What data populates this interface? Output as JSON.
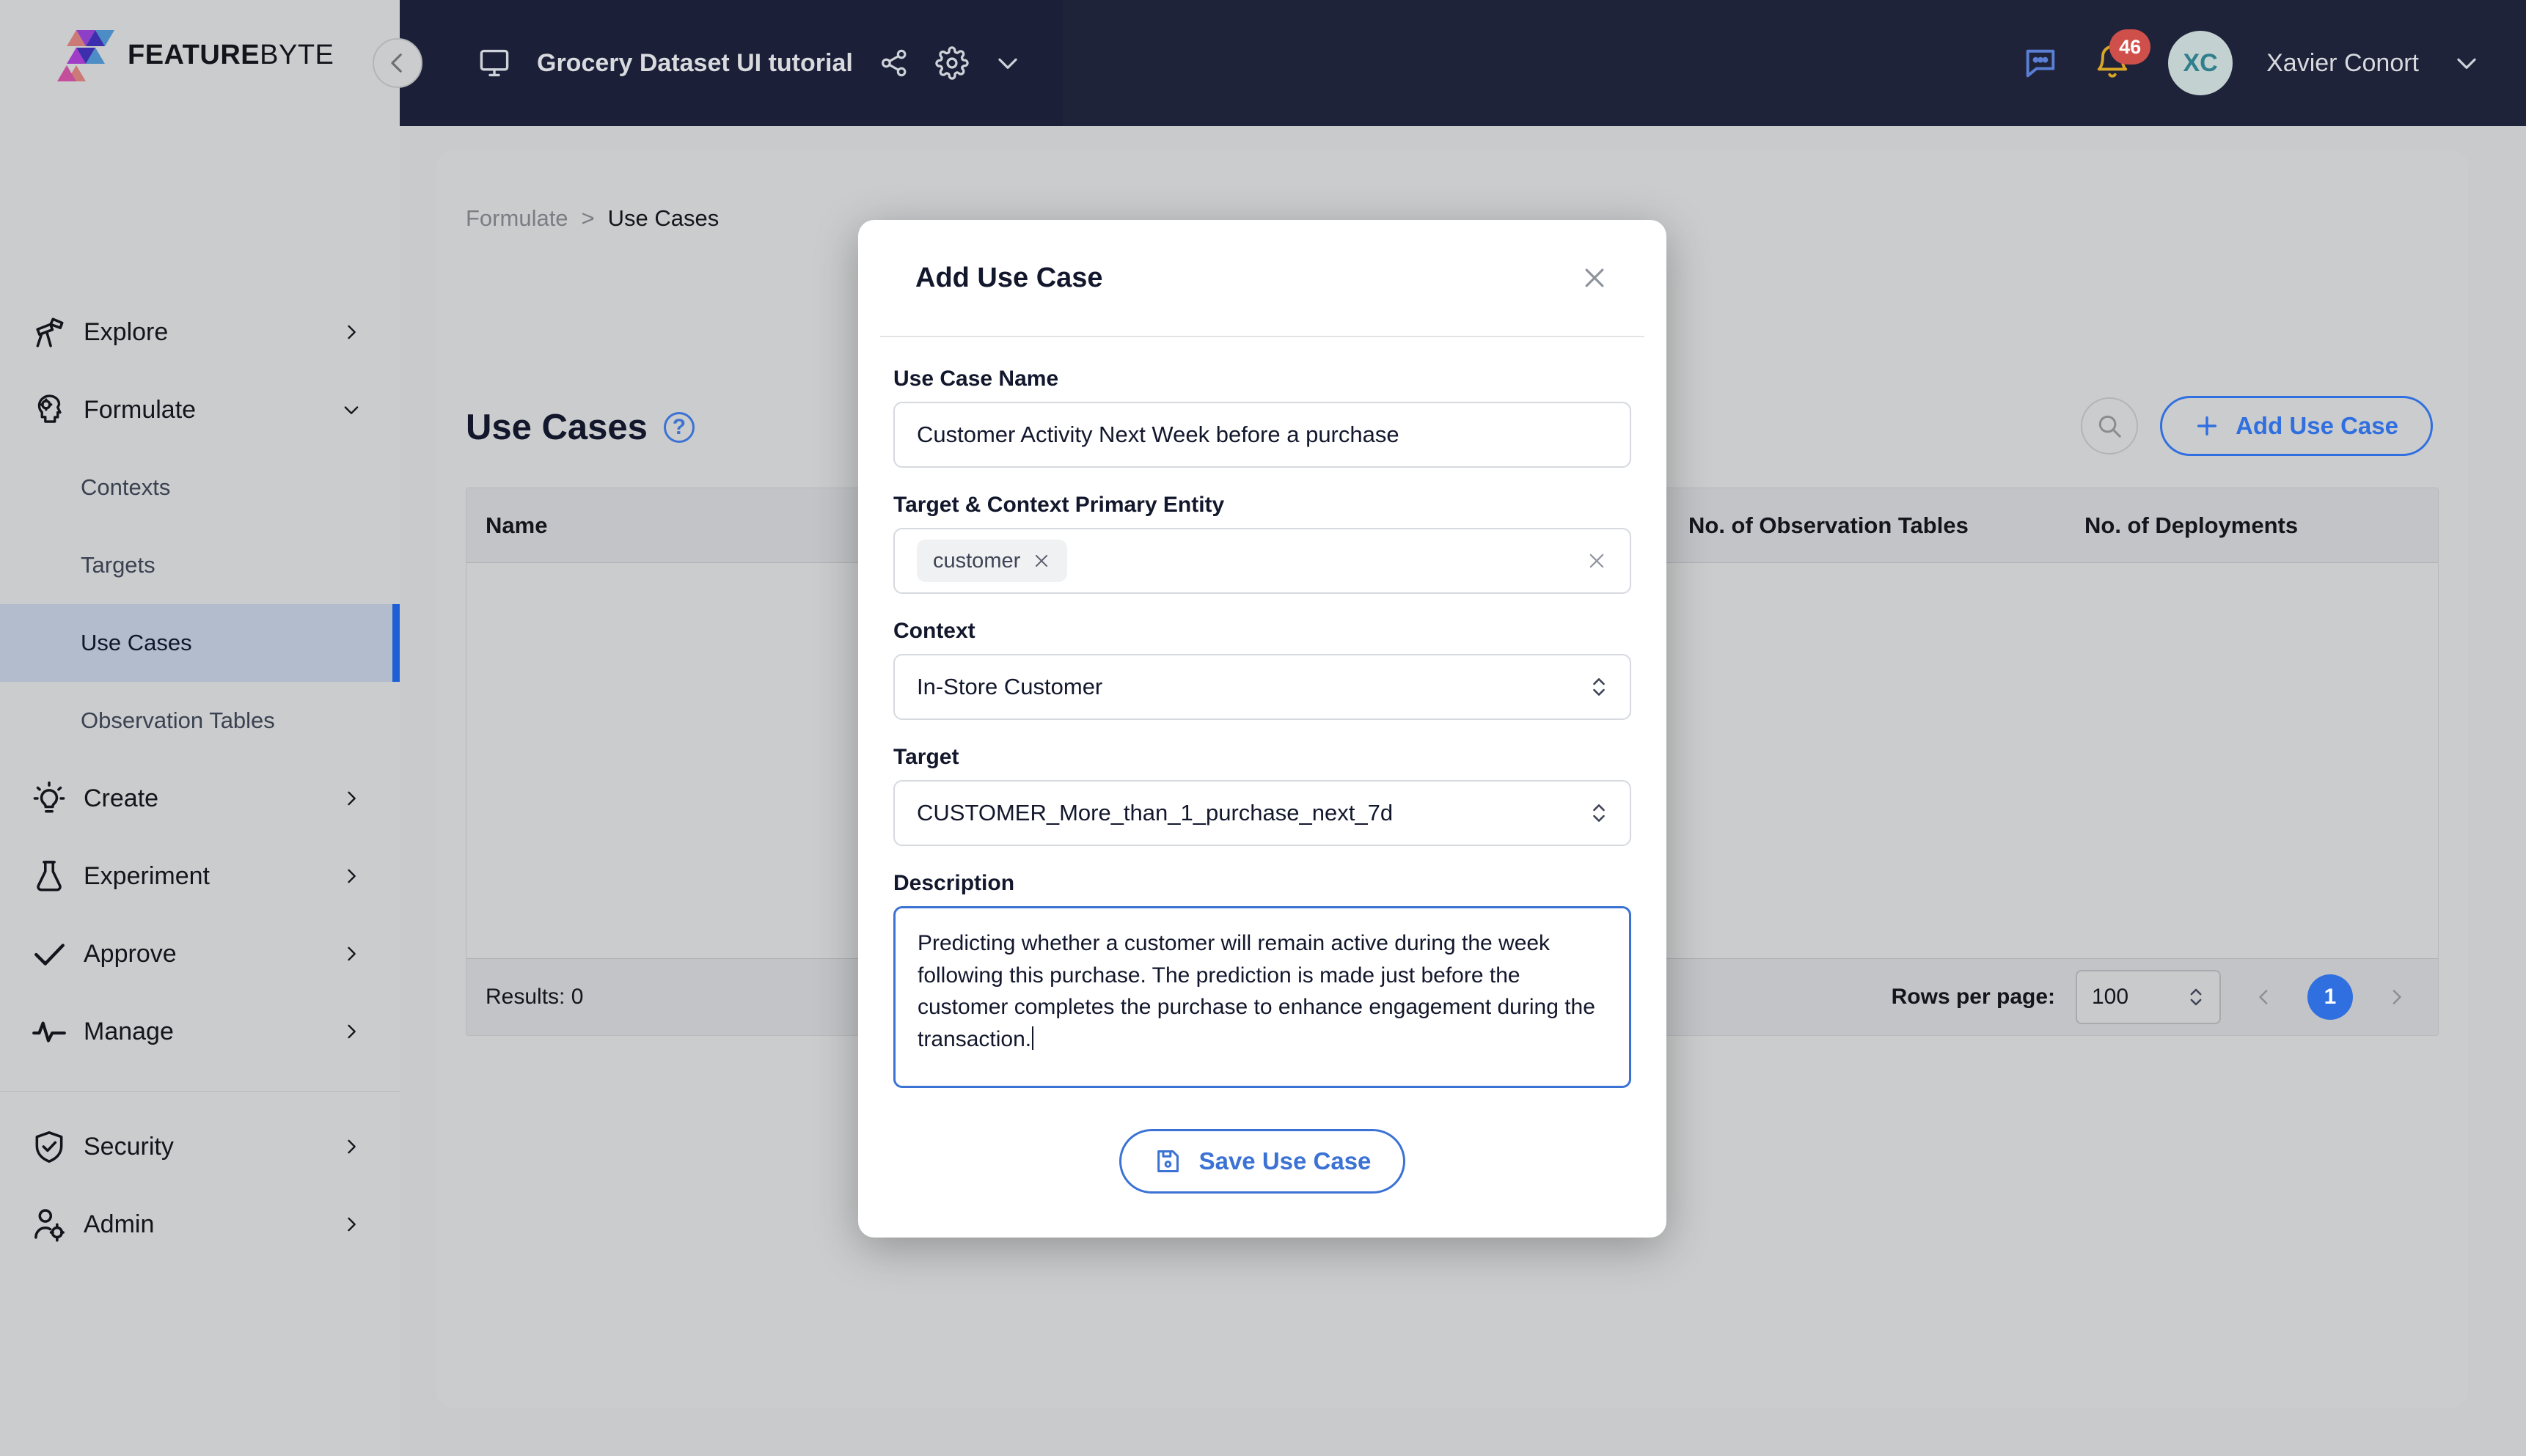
{
  "brand": {
    "name_bold": "FEATURE",
    "name_light": "BYTE",
    "colors": {
      "accent_blue": "#2f6fe0",
      "header_navy": "#1e233a",
      "page_gray": "#cbcccd",
      "badge_red": "#cf4f4b"
    }
  },
  "topbar": {
    "project_title": "Grocery Dataset UI tutorial",
    "monitor_icon": "monitor-icon",
    "share_icon": "share-icon",
    "gear_icon": "gear-icon",
    "project_chevron_icon": "chevron-down-icon",
    "chat_icon": "chat-bubble-icon",
    "bell_icon": "bell-icon",
    "notification_count": "46",
    "avatar_initials": "XC",
    "user_name": "Xavier Conort",
    "user_chevron_icon": "chevron-down-icon"
  },
  "sidebar": {
    "collapse_icon": "chevron-left-icon",
    "items": [
      {
        "label": "Explore",
        "icon": "telescope-icon",
        "chevron": "chevron-right-icon",
        "expanded": false
      },
      {
        "label": "Formulate",
        "icon": "brain-gear-icon",
        "chevron": "chevron-down-icon",
        "expanded": true
      }
    ],
    "formulate_children": [
      {
        "label": "Contexts",
        "active": false
      },
      {
        "label": "Targets",
        "active": false
      },
      {
        "label": "Use Cases",
        "active": true
      },
      {
        "label": "Observation Tables",
        "active": false
      }
    ],
    "items_lower": [
      {
        "label": "Create",
        "icon": "lightbulb-icon",
        "chevron": "chevron-right-icon"
      },
      {
        "label": "Experiment",
        "icon": "flask-icon",
        "chevron": "chevron-right-icon"
      },
      {
        "label": "Approve",
        "icon": "check-icon",
        "chevron": "chevron-right-icon"
      },
      {
        "label": "Manage",
        "icon": "activity-pulse-icon",
        "chevron": "chevron-right-icon"
      }
    ],
    "items_footer": [
      {
        "label": "Security",
        "icon": "shield-check-icon",
        "chevron": "chevron-right-icon"
      },
      {
        "label": "Admin",
        "icon": "user-gear-icon",
        "chevron": "chevron-right-icon"
      }
    ]
  },
  "page": {
    "breadcrumb": {
      "parent": "Formulate",
      "separator": ">",
      "current": "Use Cases"
    },
    "title": "Use Cases",
    "help_icon_char": "?",
    "search_icon": "search-icon",
    "add_button_label": "Add Use Case",
    "add_button_icon": "plus-icon"
  },
  "table": {
    "columns": [
      "Name",
      "No. of Observation Tables",
      "No. of Deployments"
    ],
    "rows": [],
    "results_label": "Results: 0",
    "rows_per_page_label": "Rows per page:",
    "rows_per_page_value": "100",
    "prev_icon": "chevron-left-icon",
    "next_icon": "chevron-right-icon",
    "current_page": "1"
  },
  "modal": {
    "title": "Add Use Case",
    "close_icon": "close-icon",
    "fields": {
      "use_case_name": {
        "label": "Use Case Name",
        "value": "Customer Activity Next Week before a purchase"
      },
      "primary_entity": {
        "label": "Target & Context Primary Entity",
        "chip": "customer",
        "chip_remove_icon": "close-icon",
        "clear_icon": "close-icon"
      },
      "context": {
        "label": "Context",
        "value": "In-Store Customer",
        "stepper_icon": "chevron-up-down-icon"
      },
      "target": {
        "label": "Target",
        "value": "CUSTOMER_More_than_1_purchase_next_7d",
        "stepper_icon": "chevron-up-down-icon"
      },
      "description": {
        "label": "Description",
        "value": "Predicting whether a customer will remain active during the week following this purchase. The prediction is made just before the customer completes the purchase to enhance engagement during the transaction.",
        "focused": true
      }
    },
    "save_button_label": "Save Use Case",
    "save_button_icon": "floppy-disk-icon"
  }
}
